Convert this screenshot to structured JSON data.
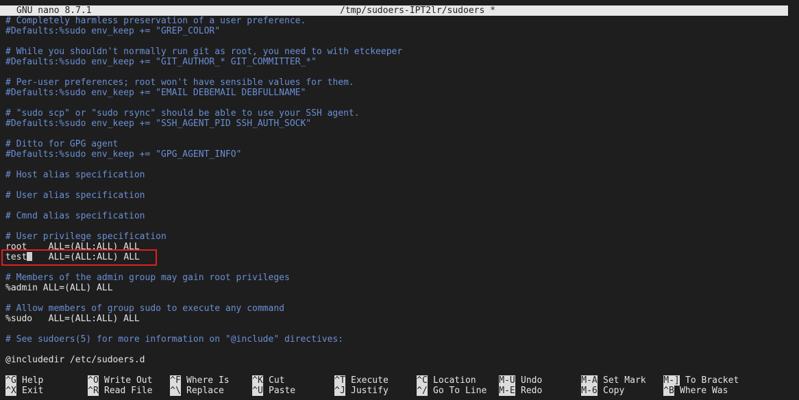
{
  "titlebar": {
    "app": "GNU nano 8.7.1",
    "file": "/tmp/sudoers-IPT2lr/sudoers *"
  },
  "editor": {
    "lines": [
      {
        "type": "comment",
        "text": "# Completely harmless preservation of a user preference."
      },
      {
        "type": "comment",
        "text": "#Defaults:%sudo env_keep += \"GREP_COLOR\""
      },
      {
        "type": "blank",
        "text": ""
      },
      {
        "type": "comment",
        "text": "# While you shouldn't normally run git as root, you need to with etckeeper"
      },
      {
        "type": "comment",
        "text": "#Defaults:%sudo env_keep += \"GIT_AUTHOR_* GIT_COMMITTER_*\""
      },
      {
        "type": "blank",
        "text": ""
      },
      {
        "type": "comment",
        "text": "# Per-user preferences; root won't have sensible values for them."
      },
      {
        "type": "comment",
        "text": "#Defaults:%sudo env_keep += \"EMAIL DEBEMAIL DEBFULLNAME\""
      },
      {
        "type": "blank",
        "text": ""
      },
      {
        "type": "comment",
        "text": "# \"sudo scp\" or \"sudo rsync\" should be able to use your SSH agent."
      },
      {
        "type": "comment",
        "text": "#Defaults:%sudo env_keep += \"SSH_AGENT_PID SSH_AUTH_SOCK\""
      },
      {
        "type": "blank",
        "text": ""
      },
      {
        "type": "comment",
        "text": "# Ditto for GPG agent"
      },
      {
        "type": "comment",
        "text": "#Defaults:%sudo env_keep += \"GPG_AGENT_INFO\""
      },
      {
        "type": "blank",
        "text": ""
      },
      {
        "type": "comment",
        "text": "# Host alias specification"
      },
      {
        "type": "blank",
        "text": ""
      },
      {
        "type": "comment",
        "text": "# User alias specification"
      },
      {
        "type": "blank",
        "text": ""
      },
      {
        "type": "comment",
        "text": "# Cmnd alias specification"
      },
      {
        "type": "blank",
        "text": ""
      },
      {
        "type": "comment",
        "text": "# User privilege specification"
      },
      {
        "type": "plain",
        "text": "root    ALL=(ALL:ALL) ALL"
      },
      {
        "type": "cursorline",
        "before": "test",
        "after": "   ALL=(ALL:ALL) ALL"
      },
      {
        "type": "blank",
        "text": ""
      },
      {
        "type": "comment",
        "text": "# Members of the admin group may gain root privileges"
      },
      {
        "type": "plain",
        "text": "%admin ALL=(ALL) ALL"
      },
      {
        "type": "blank",
        "text": ""
      },
      {
        "type": "comment",
        "text": "# Allow members of group sudo to execute any command"
      },
      {
        "type": "plain",
        "text": "%sudo   ALL=(ALL:ALL) ALL"
      },
      {
        "type": "blank",
        "text": ""
      },
      {
        "type": "comment",
        "text": "# See sudoers(5) for more information on \"@include\" directives:"
      },
      {
        "type": "blank",
        "text": ""
      },
      {
        "type": "plain",
        "text": "@includedir /etc/sudoers.d"
      }
    ]
  },
  "shortcuts": [
    {
      "key": "^G",
      "label": "Help",
      "name": "help"
    },
    {
      "key": "^X",
      "label": "Exit",
      "name": "exit"
    },
    {
      "key": "^O",
      "label": "Write Out",
      "name": "write-out"
    },
    {
      "key": "^R",
      "label": "Read File",
      "name": "read-file"
    },
    {
      "key": "^F",
      "label": "Where Is",
      "name": "where-is"
    },
    {
      "key": "^\\",
      "label": "Replace",
      "name": "replace"
    },
    {
      "key": "^K",
      "label": "Cut",
      "name": "cut"
    },
    {
      "key": "^U",
      "label": "Paste",
      "name": "paste"
    },
    {
      "key": "^T",
      "label": "Execute",
      "name": "execute"
    },
    {
      "key": "^J",
      "label": "Justify",
      "name": "justify"
    },
    {
      "key": "^C",
      "label": "Location",
      "name": "location"
    },
    {
      "key": "^/",
      "label": "Go To Line",
      "name": "go-to-line"
    },
    {
      "key": "M-U",
      "label": "Undo",
      "name": "undo"
    },
    {
      "key": "M-E",
      "label": "Redo",
      "name": "redo"
    },
    {
      "key": "M-A",
      "label": "Set Mark",
      "name": "set-mark"
    },
    {
      "key": "M-6",
      "label": "Copy",
      "name": "copy"
    },
    {
      "key": "M-]",
      "label": "To Bracket",
      "name": "to-bracket"
    },
    {
      "key": "^B",
      "label": "Where Was",
      "name": "where-was"
    }
  ]
}
